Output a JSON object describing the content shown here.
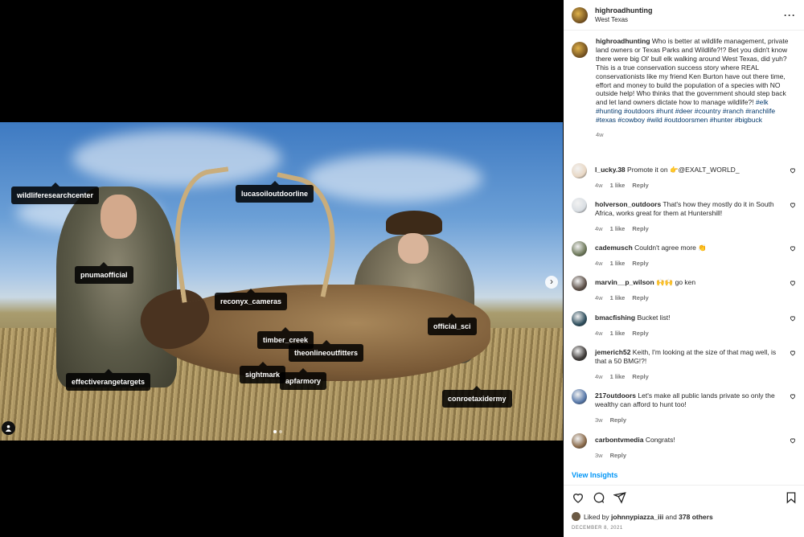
{
  "post": {
    "username": "highroadhunting",
    "location": "West Texas"
  },
  "photo_tags": [
    "wildliferesearchcenter",
    "lucasoiloutdoorline",
    "pnumaofficial",
    "reconyx_cameras",
    "official_sci",
    "timber_creek",
    "theonlineoutfitters",
    "sightmark",
    "apfarmory",
    "effectiverangetargets",
    "conroetaxidermy"
  ],
  "caption": {
    "username": "highroadhunting",
    "text": "Who is better at wildlife management, private land owners or Texas Parks and Wildlife?!? Bet you didn't know there were big Ol' bull elk walking around West Texas, did yuh? This is a true conservation success story where REAL conservationists like my friend Ken Burton have out there time, effort and money to build the population of a species with NO outside help! Who thinks that the government should step back and let land owners dictate how to manage wildlife?!",
    "hashtags": "#elk #hunting #outdoors #hunt #deer #country #ranch #ranchlife #texas #cowboy #wild #outdoorsmen #hunter #bigbuck",
    "age": "4w"
  },
  "comments": [
    {
      "user": "l_ucky.38",
      "text": "Promote it on 👉@EXALT_WORLD_",
      "age": "4w",
      "likes": "1 like",
      "reply": "Reply",
      "avatar_color": "#e8d7c4"
    },
    {
      "user": "holverson_outdoors",
      "text": "That's how they mostly do it in South Africa, works great for them at Huntershill!",
      "age": "4w",
      "likes": "1 like",
      "reply": "Reply",
      "avatar_color": "#d8dde2"
    },
    {
      "user": "cademusch",
      "text": "Couldn't agree more 👏",
      "age": "4w",
      "likes": "1 like",
      "reply": "Reply",
      "avatar_color": "#6f7a5c"
    },
    {
      "user": "marvin__p_wilson",
      "text": "🙌🙌 go ken",
      "age": "4w",
      "likes": "1 like",
      "reply": "Reply",
      "avatar_color": "#5d5048"
    },
    {
      "user": "bmacfishing",
      "text": "Bucket list!",
      "age": "4w",
      "likes": "1 like",
      "reply": "Reply",
      "avatar_color": "#2f4f5e"
    },
    {
      "user": "jemerich52",
      "text": "Keith, I'm looking at the size of that mag well, is that a 50 BMG!?!",
      "age": "4w",
      "likes": "1 like",
      "reply": "Reply",
      "avatar_color": "#3e3a38"
    },
    {
      "user": "217outdoors",
      "text": "Let's make all public lands private so only the wealthy can afford to hunt too!",
      "age": "3w",
      "likes": "",
      "reply": "Reply",
      "avatar_color": "#5677a8"
    },
    {
      "user": "carbontvmedia",
      "text": "Congrats!",
      "age": "3w",
      "likes": "",
      "reply": "Reply",
      "avatar_color": "#8a6a4a"
    }
  ],
  "insights_label": "View Insights",
  "likes": {
    "prefix": "Liked by",
    "user": "johnnypiazza_iii",
    "middle": "and",
    "others": "378 others"
  },
  "date": "DECEMBER 8, 2021",
  "more_glyph": "···",
  "next_glyph": "›"
}
